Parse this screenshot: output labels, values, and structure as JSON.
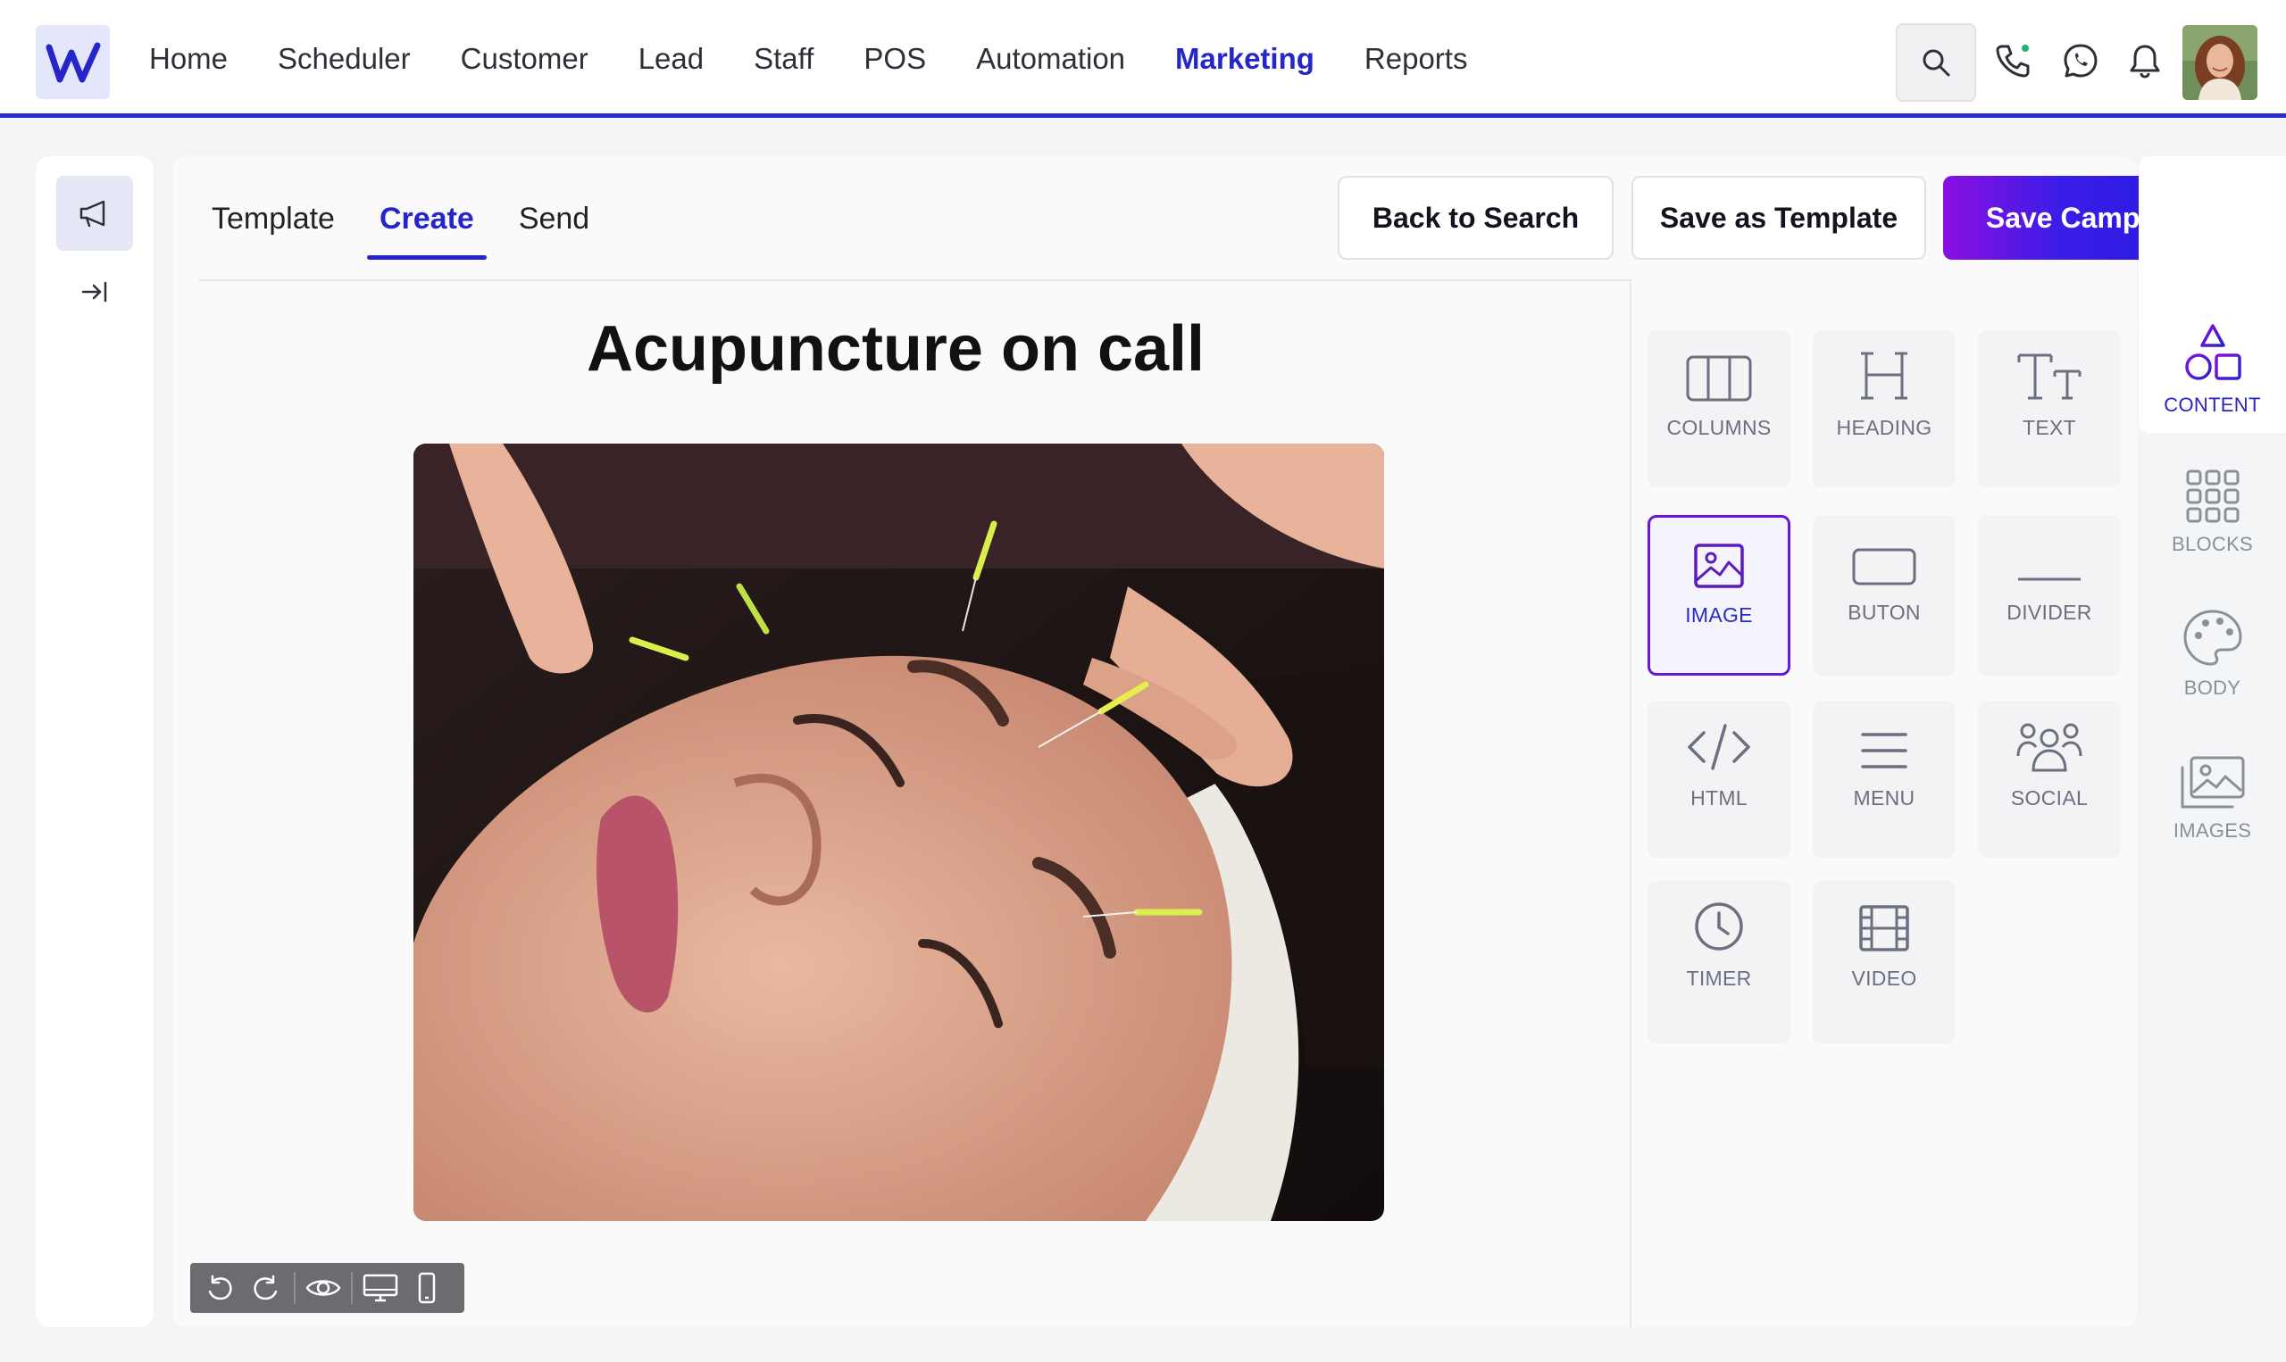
{
  "nav": {
    "items": [
      {
        "label": "Home"
      },
      {
        "label": "Scheduler"
      },
      {
        "label": "Customer"
      },
      {
        "label": "Lead"
      },
      {
        "label": "Staff"
      },
      {
        "label": "POS"
      },
      {
        "label": "Automation"
      },
      {
        "label": "Marketing",
        "active": true
      },
      {
        "label": "Reports"
      }
    ]
  },
  "tabs": [
    {
      "label": "Template"
    },
    {
      "label": "Create",
      "active": true
    },
    {
      "label": "Send"
    }
  ],
  "actions": {
    "back_label": "Back to Search",
    "save_template_label": "Save as Template",
    "save_campaign_label": "Save Campaign"
  },
  "canvas": {
    "title": "Acupuncture on call"
  },
  "tools": [
    {
      "label": "COLUMNS",
      "icon": "columns-icon"
    },
    {
      "label": "HEADING",
      "icon": "heading-icon"
    },
    {
      "label": "TEXT",
      "icon": "text-icon"
    },
    {
      "label": "IMAGE",
      "icon": "image-icon",
      "selected": true
    },
    {
      "label": "BUTON",
      "icon": "button-icon"
    },
    {
      "label": "DIVIDER",
      "icon": "divider-icon"
    },
    {
      "label": "HTML",
      "icon": "code-icon"
    },
    {
      "label": "MENU",
      "icon": "menu-icon"
    },
    {
      "label": "SOCIAL",
      "icon": "users-icon"
    },
    {
      "label": "TIMER",
      "icon": "clock-icon"
    },
    {
      "label": "VIDEO",
      "icon": "film-icon"
    }
  ],
  "side_panel": [
    {
      "label": "CONTENT",
      "icon": "shapes-icon",
      "active": true
    },
    {
      "label": "BLOCKS",
      "icon": "grid-icon"
    },
    {
      "label": "BODY",
      "icon": "palette-icon"
    },
    {
      "label": "IMAGES",
      "icon": "images-icon"
    }
  ],
  "colors": {
    "accent": "#2525c9",
    "gradient_start": "#8a0fe0",
    "gradient_end": "#1f1bdc"
  }
}
